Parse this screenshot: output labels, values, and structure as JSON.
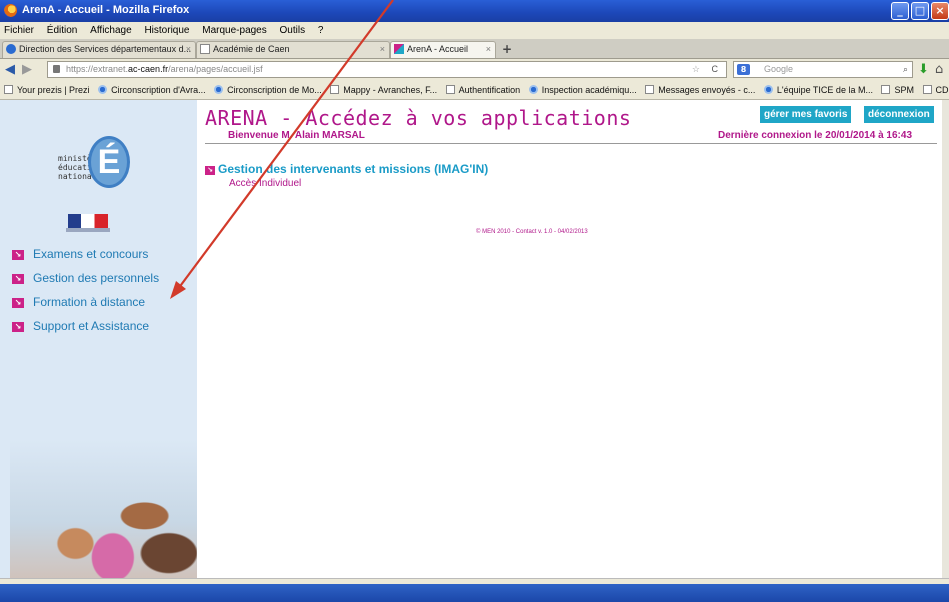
{
  "window": {
    "title": "ArenA - Accueil - Mozilla Firefox",
    "controls": [
      "minimize",
      "maximize",
      "close"
    ]
  },
  "menubar": [
    "Fichier",
    "Édition",
    "Affichage",
    "Historique",
    "Marque-pages",
    "Outils",
    "?"
  ],
  "tabs": [
    {
      "label": "Direction des Services départementaux d...",
      "active": false
    },
    {
      "label": "Académie de Caen",
      "active": false
    },
    {
      "label": "ArenA - Accueil",
      "active": true
    }
  ],
  "navbar": {
    "url_prefix": "https://extranet.",
    "url_domain": "ac-caen.fr",
    "url_path": "/arena/pages/accueil.jsf",
    "search_placeholder": "Google"
  },
  "bookmarks": [
    "Your prezis | Prezi",
    "Circonscription d'Avra...",
    "Circonscription de Mo...",
    "Mappy - Avranches, F...",
    "Authentification",
    "Inspection académiqu...",
    "Messages envoyés - c...",
    "L'équipe TICE de la M...",
    "SPM",
    "CDDP de la Manche"
  ],
  "sidebar": {
    "logo_lines": [
      "ministère",
      "éducation",
      "nationale"
    ],
    "logo_letter": "É",
    "items": [
      {
        "label": "Examens et concours"
      },
      {
        "label": "Gestion des personnels"
      },
      {
        "label": "Formation à distance"
      },
      {
        "label": "Support et Assistance"
      }
    ]
  },
  "main": {
    "title": "ARENA - Accédez à vos applications",
    "buttons": {
      "favorites": "gérer mes favoris",
      "logout": "déconnexion"
    },
    "welcome": "Bienvenue M. Alain MARSAL",
    "last_login": "Dernière connexion le 20/01/2014 à 16:43",
    "app_group": "Gestion des intervenants et missions (IMAG'IN)",
    "app_link": "Accès Individuel",
    "footer": "© MEN 2010 - Contact v. 1.0 - 04/02/2013"
  },
  "colors": {
    "brand_magenta": "#b0178a",
    "link_cyan": "#1a9bc7",
    "button_cyan": "#1fa6c7",
    "sidebar_bg": "#dbe8f5",
    "annotation_arrow": "#d23a2a"
  }
}
